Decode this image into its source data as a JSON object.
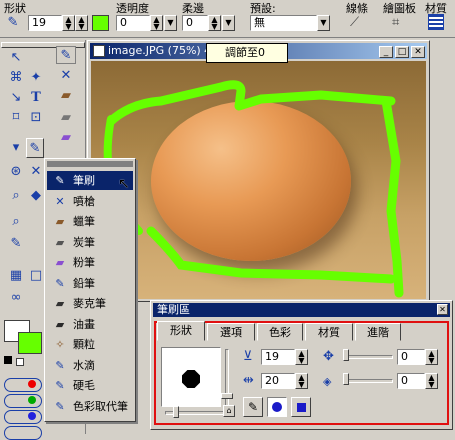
{
  "toolbar": {
    "shape_label": "形狀",
    "size_value": "19",
    "opacity_label": "透明度",
    "opacity_value": "0",
    "soft_label": "柔邊",
    "soft_value": "0",
    "preset_label": "預設:",
    "preset_value": "無",
    "line_label": "線條",
    "tablet_label": "繪圖板",
    "material_label": "材質",
    "fill_color": "#66ff00"
  },
  "tooltip": "調節至0",
  "image_window": {
    "title": "image.JPG (75%) 44"
  },
  "brush_menu": {
    "items": [
      {
        "label": "筆刷",
        "icon": "brush-icon",
        "selected": true
      },
      {
        "label": "噴槍",
        "icon": "airbrush-icon"
      },
      {
        "label": "蠟筆",
        "icon": "crayon-icon"
      },
      {
        "label": "炭筆",
        "icon": "charcoal-icon"
      },
      {
        "label": "粉筆",
        "icon": "chalk-icon"
      },
      {
        "label": "鉛筆",
        "icon": "pencil-icon"
      },
      {
        "label": "麥克筆",
        "icon": "marker-icon"
      },
      {
        "label": "油畫",
        "icon": "oil-paint-icon"
      },
      {
        "label": "顆粒",
        "icon": "grain-icon"
      },
      {
        "label": "水滴",
        "icon": "water-drop-icon"
      },
      {
        "label": "硬毛",
        "icon": "bristle-icon"
      },
      {
        "label": "色彩取代筆",
        "icon": "color-replace-icon"
      }
    ]
  },
  "brush_panel": {
    "title": "筆刷區",
    "tabs": [
      "形狀",
      "選項",
      "色彩",
      "材質",
      "進階"
    ],
    "size_value": "19",
    "opacity_value": "20",
    "right_value_1": "0",
    "right_value_2": "0"
  },
  "colors": {
    "stroke": "#66ff00",
    "foreground": "#ffffff",
    "background_swatch": "#66ff00"
  }
}
